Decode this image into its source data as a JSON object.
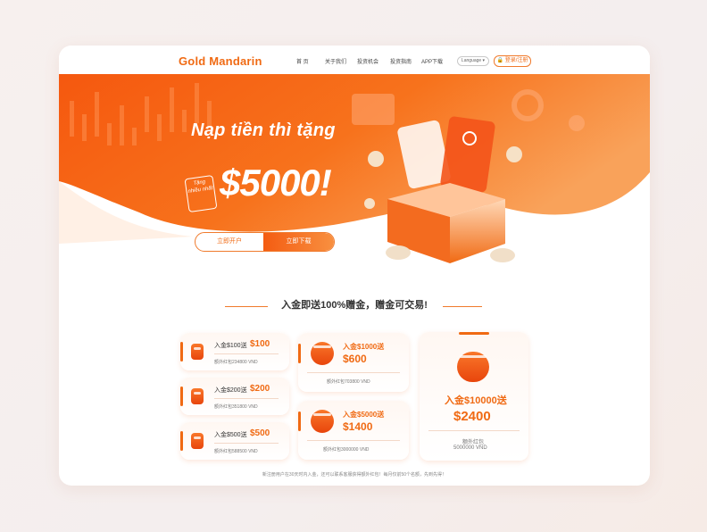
{
  "header": {
    "logo": "Gold Mandarin",
    "nav": [
      "首 页",
      "关于我们",
      "投资机会",
      "投资指南",
      "APP下载"
    ],
    "language": "Language",
    "login": "登录/注册"
  },
  "hero": {
    "headline": "Nạp tiền thì tặng",
    "tag": "Tặng nhiều nhất",
    "amount": "$5000!",
    "btn_open": "立即开户",
    "btn_download": "立即下载"
  },
  "section": {
    "title": "入金即送100%赠金，赠金可交易!"
  },
  "cards": [
    {
      "title": "入金$100送",
      "value": "$100",
      "sub": "额外红包234800 VND"
    },
    {
      "title": "入金$200送",
      "value": "$200",
      "sub": "额外红包351800 VND"
    },
    {
      "title": "入金$500送",
      "value": "$500",
      "sub": "额外红包588500 VND"
    },
    {
      "title": "入金$1000送",
      "value": "$600",
      "sub": "额外红包703800 VND"
    },
    {
      "title": "入金$5000送",
      "value": "$1400",
      "sub": "额外红包3000000 VND"
    },
    {
      "title": "入金$10000送",
      "value": "$2400",
      "sub": "额外红包",
      "sub2": "5000000 VND"
    }
  ],
  "footnote": "新注册用户在30天时内入金，还可以联系客服获得额外红包！每月仅前50个名额，先到先得！",
  "colors": {
    "accent": "#f06a13",
    "accent_light": "#f89040"
  }
}
